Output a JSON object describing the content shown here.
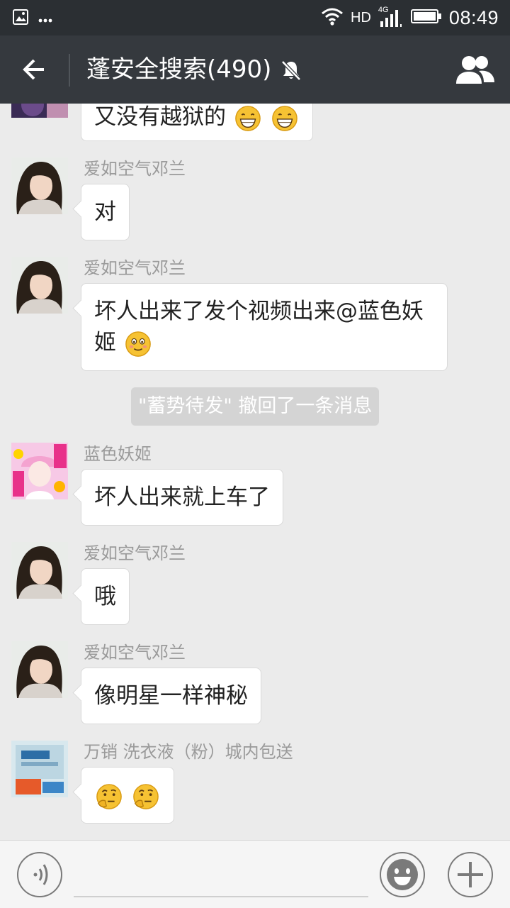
{
  "status_bar": {
    "network": "HD",
    "signal_type": "4G",
    "time": "08:49",
    "icons": [
      "image-icon",
      "more-dots-icon",
      "wifi-icon",
      "signal-icon",
      "battery-icon"
    ]
  },
  "header": {
    "title": "蓬安全搜索(490)",
    "icons": [
      "back-arrow-icon",
      "mute-icon",
      "group-members-icon"
    ]
  },
  "messages": [
    {
      "sender": "",
      "text": "又没有越狱的",
      "emojis": [
        "grin",
        "grin"
      ],
      "avatar": "purple-photo"
    },
    {
      "sender": "爱如空气邓兰",
      "text": "对",
      "emojis": [],
      "avatar": "woman-photo"
    },
    {
      "sender": "爱如空气邓兰",
      "text_line1": "坏人出来了发个视频出来@蓝色妖",
      "text_line2": "姬",
      "emojis": [
        "blush"
      ],
      "avatar": "woman-photo"
    },
    {
      "sender": "蓝色妖姬",
      "text": "坏人出来就上车了",
      "emojis": [],
      "avatar": "pink-hat-photo"
    },
    {
      "sender": "爱如空气邓兰",
      "text": "哦",
      "emojis": [],
      "avatar": "woman-photo"
    },
    {
      "sender": "爱如空气邓兰",
      "text": "像明星一样神秘",
      "emojis": [],
      "avatar": "woman-photo"
    },
    {
      "sender": "万销 洗衣液（粉）城内包送",
      "text": "",
      "emojis": [
        "thinking",
        "thinking"
      ],
      "avatar": "product-photo"
    }
  ],
  "system_notice": "\"蓄势待发\" 撤回了一条消息",
  "input_bar": {
    "icons": [
      "voice-icon",
      "emoji-icon",
      "plus-icon"
    ],
    "value": ""
  },
  "colors": {
    "statusbar_bg": "#2b2f33",
    "titlebar_bg": "#35393e",
    "chat_bg": "#ebebeb",
    "bubble_bg": "#ffffff",
    "sender_text": "#9a9a9a"
  }
}
